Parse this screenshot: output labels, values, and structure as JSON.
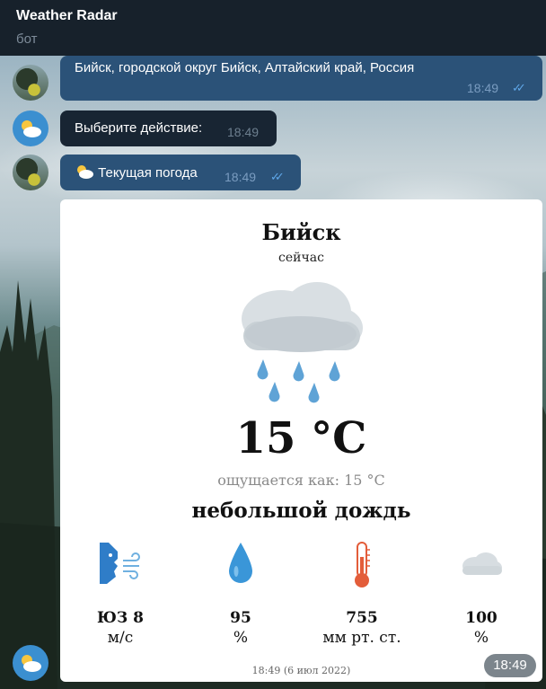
{
  "header": {
    "title": "Weather Radar",
    "subtitle": "бот"
  },
  "messages": [
    {
      "type": "out",
      "text": "Бийск, городской округ Бийск, Алтайский край, Россия",
      "time": "18:49",
      "status": "read"
    },
    {
      "type": "in",
      "text": "Выберите действие:",
      "time": "18:49"
    },
    {
      "type": "out",
      "icon": "sun-behind-cloud-icon",
      "text": "Текущая погода",
      "time": "18:49",
      "status": "read"
    }
  ],
  "weather_card": {
    "city": "Бийск",
    "when": "сейчас",
    "condition_icon": "rain-cloud-icon",
    "temperature": "15 °C",
    "feels_like": "ощущается как: 15 °C",
    "description": "небольшой дождь",
    "stats": [
      {
        "icon": "wind-icon",
        "value": "ЮЗ 8",
        "unit": "м/с"
      },
      {
        "icon": "humidity-drop-icon",
        "value": "95",
        "unit": "%"
      },
      {
        "icon": "thermometer-icon",
        "value": "755",
        "unit": "мм рт. ст."
      },
      {
        "icon": "cloud-icon",
        "value": "100",
        "unit": "%"
      }
    ],
    "timestamp": "18:49 (6 июл 2022)"
  },
  "last_message_time": "18:49"
}
